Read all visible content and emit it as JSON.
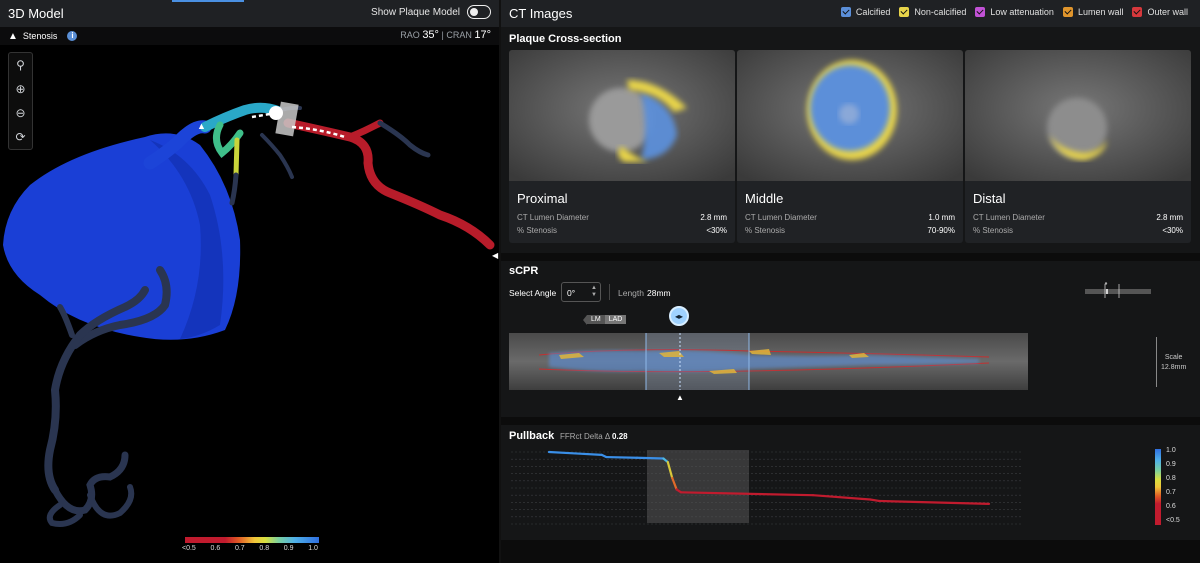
{
  "left_panel": {
    "title": "3D Model",
    "toggle_label": "Show Plaque Model",
    "stenosis_label": "Stenosis",
    "angle": {
      "rao_label": "RAO",
      "rao_value": "35°",
      "sep": "|",
      "cran_label": "CRAN",
      "cran_value": "17°"
    },
    "tools": [
      {
        "name": "pin-icon",
        "glyph": "⚲"
      },
      {
        "name": "zoom-in-icon",
        "glyph": "⊕"
      },
      {
        "name": "zoom-out-icon",
        "glyph": "⊖"
      },
      {
        "name": "reset-rotate-icon",
        "glyph": "⟳"
      }
    ],
    "legend_ticks": [
      "<0.5",
      "0.6",
      "0.7",
      "0.8",
      "0.9",
      "1.0"
    ]
  },
  "right_panel": {
    "title": "CT Images",
    "filters": [
      {
        "label": "Calcified",
        "color": "#5b8fd9"
      },
      {
        "label": "Non-calcified",
        "color": "#e8d44a"
      },
      {
        "label": "Low attenuation",
        "color": "#c252d6"
      },
      {
        "label": "Lumen wall",
        "color": "#e0952c"
      },
      {
        "label": "Outer wall",
        "color": "#d6383c"
      }
    ],
    "cross_section": {
      "title": "Plaque Cross-section",
      "cards": [
        {
          "name": "Proximal",
          "diam_label": "CT Lumen Diameter",
          "diam": "2.8 mm",
          "sten_label": "% Stenosis",
          "sten": "<30%"
        },
        {
          "name": "Middle",
          "diam_label": "CT Lumen Diameter",
          "diam": "1.0 mm",
          "sten_label": "% Stenosis",
          "sten": "70-90%"
        },
        {
          "name": "Distal",
          "diam_label": "CT Lumen Diameter",
          "diam": "2.8 mm",
          "sten_label": "% Stenosis",
          "sten": "<30%"
        }
      ]
    },
    "scpr": {
      "title": "sCPR",
      "angle_label": "Select Angle",
      "angle_value": "0°",
      "length_label": "Length",
      "length_value": "28mm",
      "tag_lm": "LM",
      "tag_lad": "LAD",
      "scale_label": "Scale",
      "scale_value": "12.8mm"
    },
    "pullback": {
      "title": "Pullback",
      "delta_label": "FFRct Delta Δ",
      "delta_value": "0.28",
      "legend_ticks": [
        "1.0",
        "0.9",
        "0.8",
        "0.7",
        "0.6",
        "<0.5"
      ]
    }
  },
  "chart_data": {
    "type": "line",
    "title": "Pullback",
    "xlabel": "",
    "ylabel": "",
    "ylim": [
      0.5,
      1.0
    ],
    "grid": true,
    "x": [
      0,
      6,
      12,
      13,
      20,
      26,
      27,
      28,
      29,
      30,
      60,
      73,
      75,
      100
    ],
    "series": [
      {
        "name": "",
        "values": [
          1.0,
          0.99,
          0.98,
          0.965,
          0.96,
          0.955,
          0.93,
          0.82,
          0.74,
          0.72,
          0.7,
          0.67,
          0.66,
          0.64
        ]
      }
    ]
  }
}
